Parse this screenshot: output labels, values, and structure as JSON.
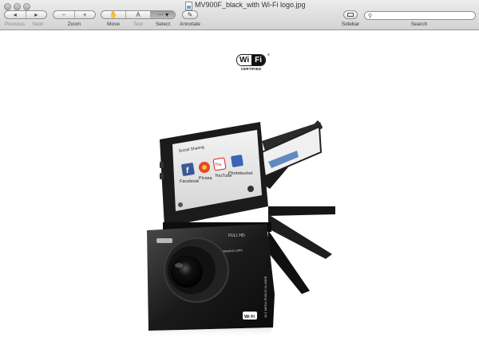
{
  "window": {
    "title": "MV900F_black_with Wi-Fi logo.jpg"
  },
  "toolbar": {
    "previous_label": "Previous",
    "next_label": "Next",
    "zoom_label": "Zoom",
    "move_label": "Move",
    "text_label": "Text",
    "select_label": "Select",
    "annotate_label": "Annotate",
    "sidebar_label": "Sidebar",
    "search_label": "Search",
    "search_value": "",
    "zoom_out_glyph": "−",
    "zoom_in_glyph": "+",
    "text_glyph": "A"
  },
  "image": {
    "wifi_logo": {
      "wi": "Wi",
      "fi": "Fi",
      "certified": "CERTIFIED",
      "reg": "®"
    },
    "camera": {
      "screen_header": "Social Sharing",
      "apps": [
        {
          "name": "Facebook",
          "glyph": "f",
          "color": "#3b5998"
        },
        {
          "name": "Picasa",
          "glyph": "",
          "color": "#e8452c"
        },
        {
          "name": "YouTube",
          "glyph": "You",
          "color": "#d41f26"
        },
        {
          "name": "Photobucket",
          "glyph": "",
          "color": "#3a64b6"
        }
      ],
      "badge_full_hd": "FULL HD",
      "badge_wifi": "Wi Fi",
      "lens_text": "SAMSUNG LENS",
      "side_text": "16.1 MEGA PIXELS 5x WIDE"
    }
  }
}
